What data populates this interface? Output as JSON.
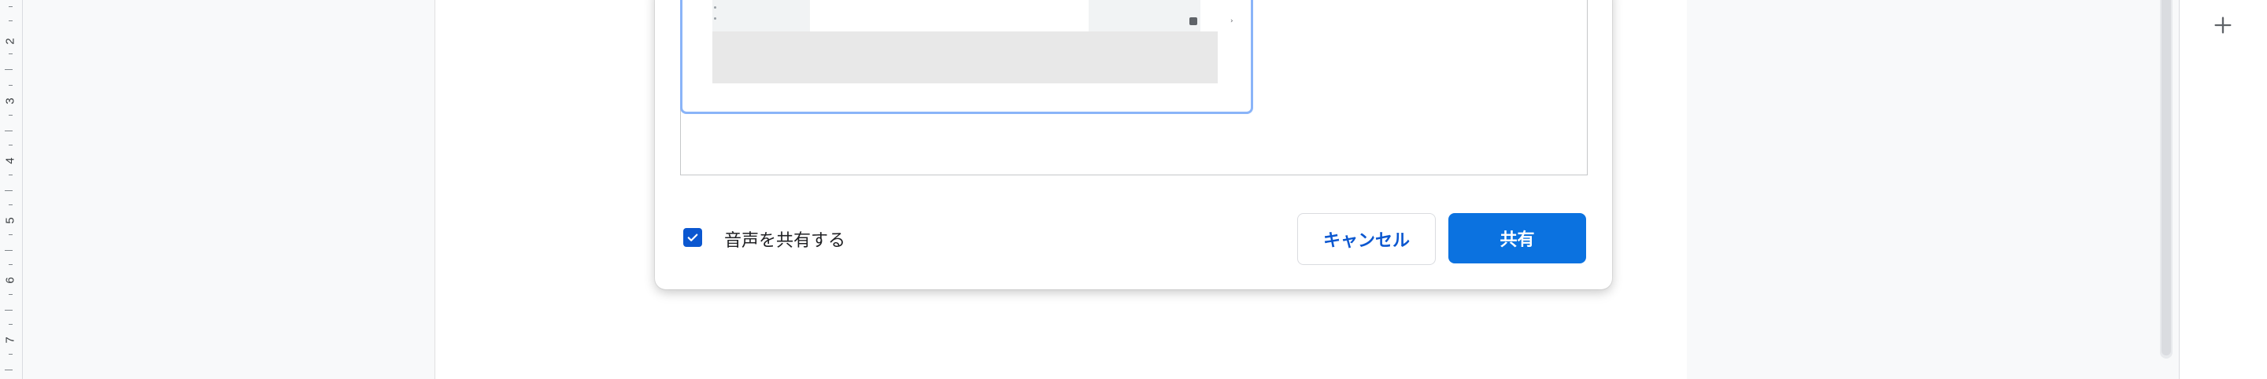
{
  "ruler": {
    "numbers": [
      "2",
      "3",
      "4",
      "5",
      "6",
      "7"
    ]
  },
  "dialog": {
    "share_audio_label": "音声を共有する",
    "share_audio_checked": true,
    "cancel_label": "キャンセル",
    "share_label": "共有"
  },
  "side_panel": {
    "add_icon": "plus-icon"
  },
  "colors": {
    "primary": "#0b72e0",
    "selection_border": "#8ab4f8",
    "checkbox": "#0b57d0"
  }
}
